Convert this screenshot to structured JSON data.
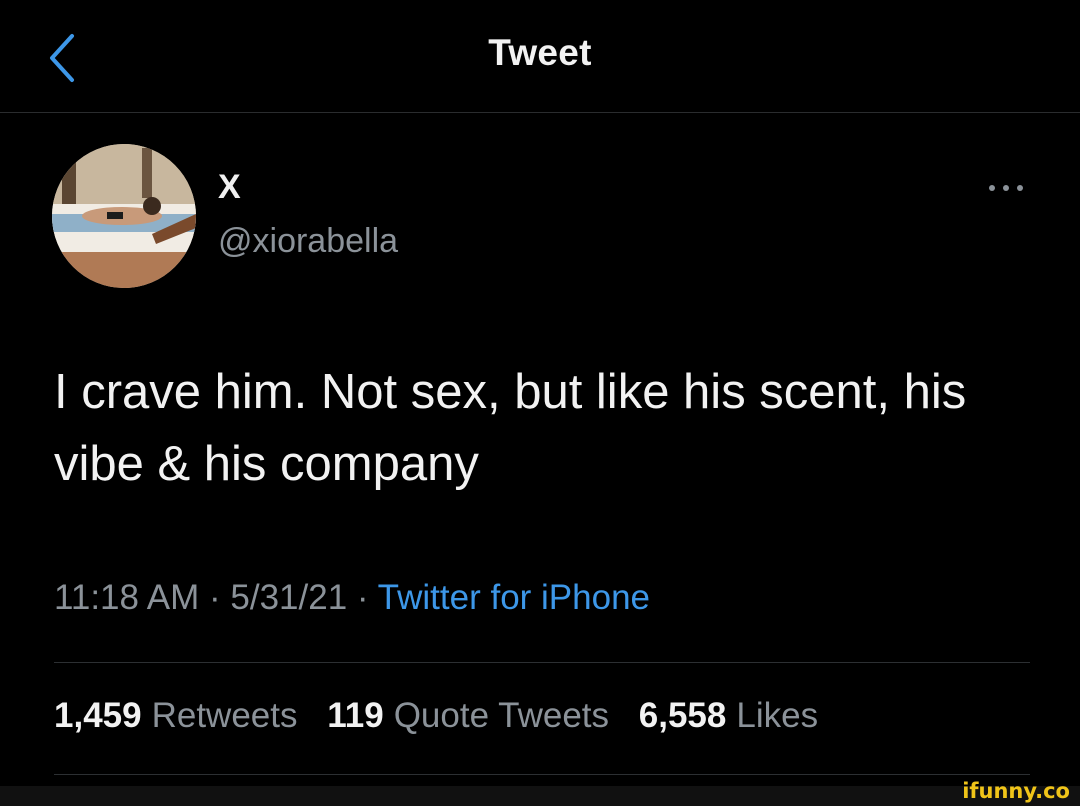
{
  "header": {
    "title": "Tweet",
    "back_icon": "chevron-left-icon"
  },
  "author": {
    "display_name": "X",
    "handle": "@xiorabella",
    "more_icon": "more-horizontal-icon"
  },
  "tweet": {
    "text": "I crave him. Not sex, but like his scent, his vibe & his company",
    "time": "11:18 AM",
    "date": "5/31/21",
    "separator": "·",
    "source": "Twitter for iPhone"
  },
  "stats": {
    "retweets_count": "1,459",
    "retweets_label": "Retweets",
    "quotes_count": "119",
    "quotes_label": "Quote Tweets",
    "likes_count": "6,558",
    "likes_label": "Likes"
  },
  "watermark": "ifunny.co",
  "colors": {
    "background": "#000000",
    "link": "#3d97e8",
    "secondary_text": "#8b9299",
    "watermark": "#f0c419"
  }
}
